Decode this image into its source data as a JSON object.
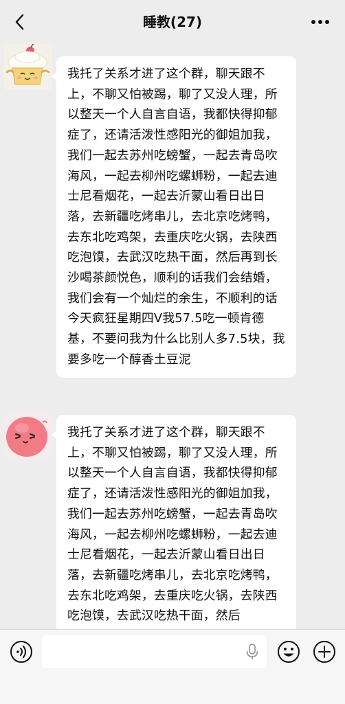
{
  "header": {
    "title": "睡教(27)"
  },
  "messages": [
    {
      "avatar": "cupcake-cartoon-avatar",
      "text": "我托了关系才进了这个群，聊天跟不上，不聊又怕被踢，聊了又没人理，所以整天一个人自言自语，我都快得抑郁症了，还请活泼性感阳光的御姐加我，我们一起去苏州吃螃蟹，一起去青岛吹海风，一起去柳州吃螺蛳粉，一起去迪士尼看烟花，一起去沂蒙山看日出日落，去新疆吃烤串儿，去北京吃烤鸭，去东北吃鸡架，去重庆吃火锅，去陕西吃泡馍，去武汉吃热干面，然后再到长沙喝茶颜悦色，顺利的话我们会结婚，我们会有一个灿烂的余生，不顺利的话今天疯狂星期四V我57.5吃一顿肯德基，不要问我为什么比别人多7.5块，我要多吃一个醇香土豆泥"
    },
    {
      "avatar": "pink-blob-avatar",
      "text": "我托了关系才进了这个群，聊天跟不上，不聊又怕被踢，聊了又没人理，所以整天一个人自言自语，我都快得抑郁症了，还请活泼性感阳光的御姐加我，我们一起去苏州吃螃蟹，一起去青岛吹海风，一起去柳州吃螺蛳粉，一起去迪士尼看烟花，一起去沂蒙山看日出日落，去新疆吃烤串儿，去北京吃烤鸭，去东北吃鸡架，去重庆吃火锅，去陕西吃泡馍，去武汉吃热干面，然后"
    }
  ],
  "input": {
    "value": "",
    "placeholder": ""
  },
  "icons": {
    "back": "chevron-left-icon",
    "more": "more-dots-icon",
    "voice": "voice-icon",
    "mic": "microphone-icon",
    "emoji": "emoji-icon",
    "plus": "plus-icon"
  },
  "colors": {
    "background": "#ededed",
    "bubble": "#ffffff",
    "text": "#111111",
    "input_bar": "#f6f6f6"
  }
}
